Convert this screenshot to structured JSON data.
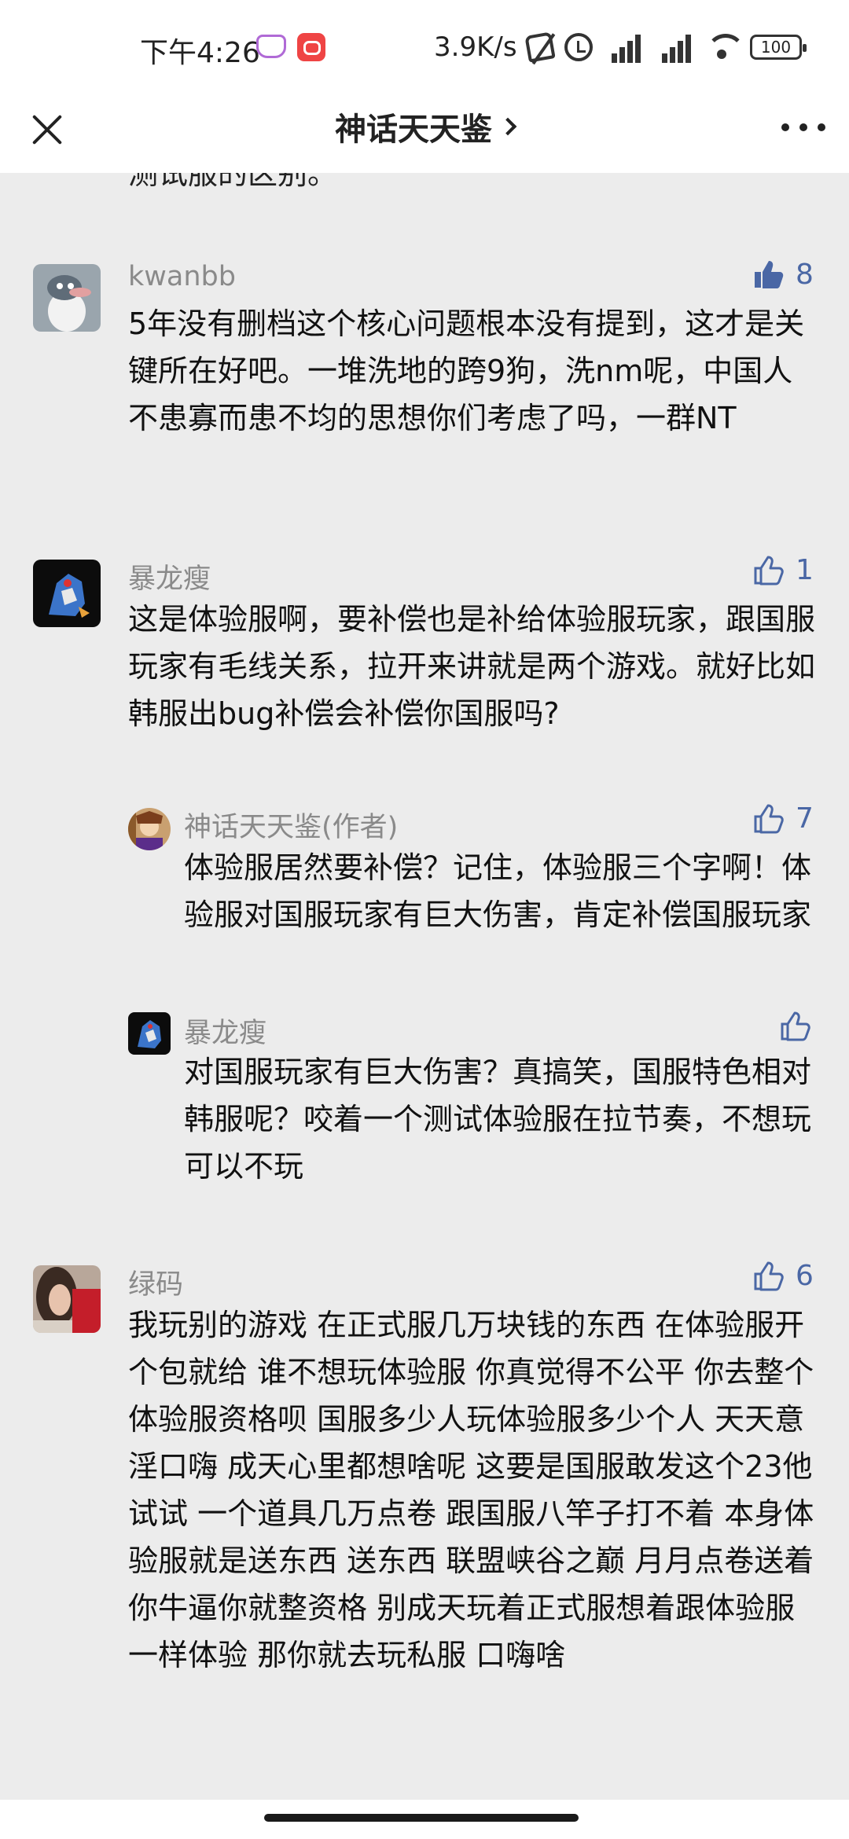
{
  "status_bar": {
    "time": "下午4:26",
    "net_speed": "3.9K/s",
    "battery": "100"
  },
  "header": {
    "title": "神话天天鉴"
  },
  "partial_text": "测试服的区别。",
  "comments": [
    {
      "name": "kwanbb",
      "likes": "8",
      "liked": true,
      "text": "5年没有删档这个核心问题根本没有提到，这才是关键所在好吧。一堆洗地的跨9狗，洗nm呢，中国人不患寡而患不均的思想你们考虑了吗，一群NT"
    },
    {
      "name": "暴龙瘦",
      "likes": "1",
      "liked": false,
      "text": "这是体验服啊，要补偿也是补给体验服玩家，跟国服玩家有毛线关系，拉开来讲就是两个游戏。就好比如韩服出bug补偿会补偿你国服吗?",
      "replies": [
        {
          "name": "神话天天鉴(作者)",
          "likes": "7",
          "text": "体验服居然要补偿？记住，体验服三个字啊！体验服对国服玩家有巨大伤害，肯定补偿国服玩家"
        },
        {
          "name": "暴龙瘦",
          "likes": "",
          "text": "对国服玩家有巨大伤害？真搞笑，国服特色相对韩服呢？咬着一个测试体验服在拉节奏，不想玩可以不玩"
        }
      ]
    },
    {
      "name": "绿码",
      "likes": "6",
      "liked": false,
      "text": "我玩别的游戏 在正式服几万块钱的东西 在体验服开个包就给 谁不想玩体验服 你真觉得不公平 你去整个体验服资格呗 国服多少人玩体验服多少个人 天天意淫口嗨 成天心里都想啥呢 这要是国服敢发这个23他试试 一个道具几万点卷 跟国服八竿子打不着  本身体验服就是送东西 送东西 联盟峡谷之巅 月月点卷送着 你牛逼你就整资格 别成天玩着正式服想着跟体验服一样体验 那你就去玩私服 口嗨啥"
    }
  ],
  "colors": {
    "like_blue": "#4a67a5",
    "background": "#ececec",
    "name_gray": "#8a8a8a"
  }
}
